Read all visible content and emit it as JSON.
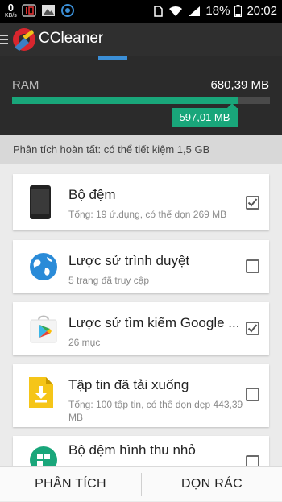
{
  "status_bar": {
    "speed_value": "0",
    "speed_unit": "KB/s",
    "battery": "18%",
    "time": "20:02"
  },
  "app_bar": {
    "title": "CCleaner"
  },
  "ram": {
    "label": "RAM",
    "total": "680,39 MB",
    "used_fraction": 0.878,
    "used_label": "597,01 MB"
  },
  "summary": "Phân tích hoàn tất: có thể tiết kiệm 1,5 GB",
  "items": [
    {
      "title": "Bộ đệm",
      "subtitle": "Tổng: 19 ứ.dụng, có thể dọn 269 MB",
      "checked": true,
      "icon": "phone-icon"
    },
    {
      "title": "Lược sử trình duyệt",
      "subtitle": "5 trang đã truy cập",
      "checked": false,
      "icon": "globe-icon"
    },
    {
      "title": "Lược sử tìm kiếm Google ...",
      "subtitle": "26 mục",
      "checked": true,
      "icon": "play-store-icon"
    },
    {
      "title": "Tập tin đã tải xuống",
      "subtitle": "Tổng: 100 tập tin, có thể dọn dẹp 443,39 MB",
      "checked": false,
      "icon": "download-file-icon"
    },
    {
      "title": "Bộ đệm hình thu nhỏ",
      "subtitle": "",
      "checked": false,
      "icon": "thumbnail-icon"
    }
  ],
  "bottom": {
    "analyze": "PHÂN TÍCH",
    "clean": "DỌN RÁC"
  },
  "colors": {
    "accent_green": "#19a67a",
    "tab_blue": "#3b8fd7",
    "app_bar": "#2f2f2f"
  }
}
